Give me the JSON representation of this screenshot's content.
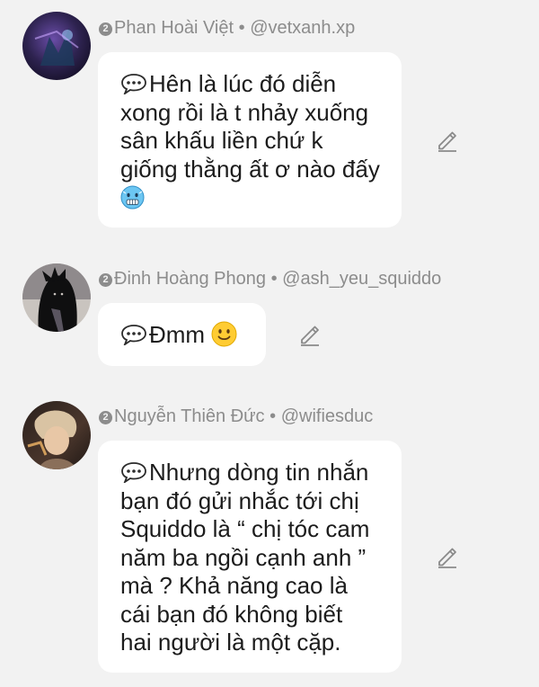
{
  "comments": [
    {
      "author": "Phan Hoài Việt",
      "badge": "2",
      "handle": "@vetxanh.xp",
      "separator": "•",
      "text": "Hên là lúc đó diễn xong rồi là t nhảy xuống sân khấu liền chứ k giống thằng ất ơ nào đấy",
      "emoji": "cold-face",
      "avatar_colors": [
        "#2a1f46",
        "#5a3e8c",
        "#1d3a5c"
      ]
    },
    {
      "author": "Đinh Hoàng Phong",
      "badge": "2",
      "handle": "@ash_yeu_squiddo",
      "separator": "•",
      "text": "Đmm",
      "emoji": "slightly-smiling-face",
      "avatar_colors": [
        "#0f0f10",
        "#5a5560",
        "#c9c4bf"
      ]
    },
    {
      "author": "Nguyễn Thiên Đức",
      "badge": "2",
      "handle": "@wifiesduc",
      "separator": "•",
      "text": "Nhưng dòng tin nhắn bạn đó gửi nhắc tới chị Squiddo là “ chị tóc cam năm ba ngồi cạnh anh ” mà ? Khả năng cao là cái bạn đó không biết hai người là một cặp.",
      "emoji": "",
      "avatar_colors": [
        "#3b2a25",
        "#c8a076",
        "#8a6f5a"
      ]
    }
  ],
  "icons": {
    "speech_bubble": "speech-balloon-icon",
    "edit": "pencil-icon"
  },
  "colors": {
    "background": "#f2f2f2",
    "bubble": "#ffffff",
    "meta_text": "#8c8c8c",
    "body_text": "#1c1c1c"
  }
}
